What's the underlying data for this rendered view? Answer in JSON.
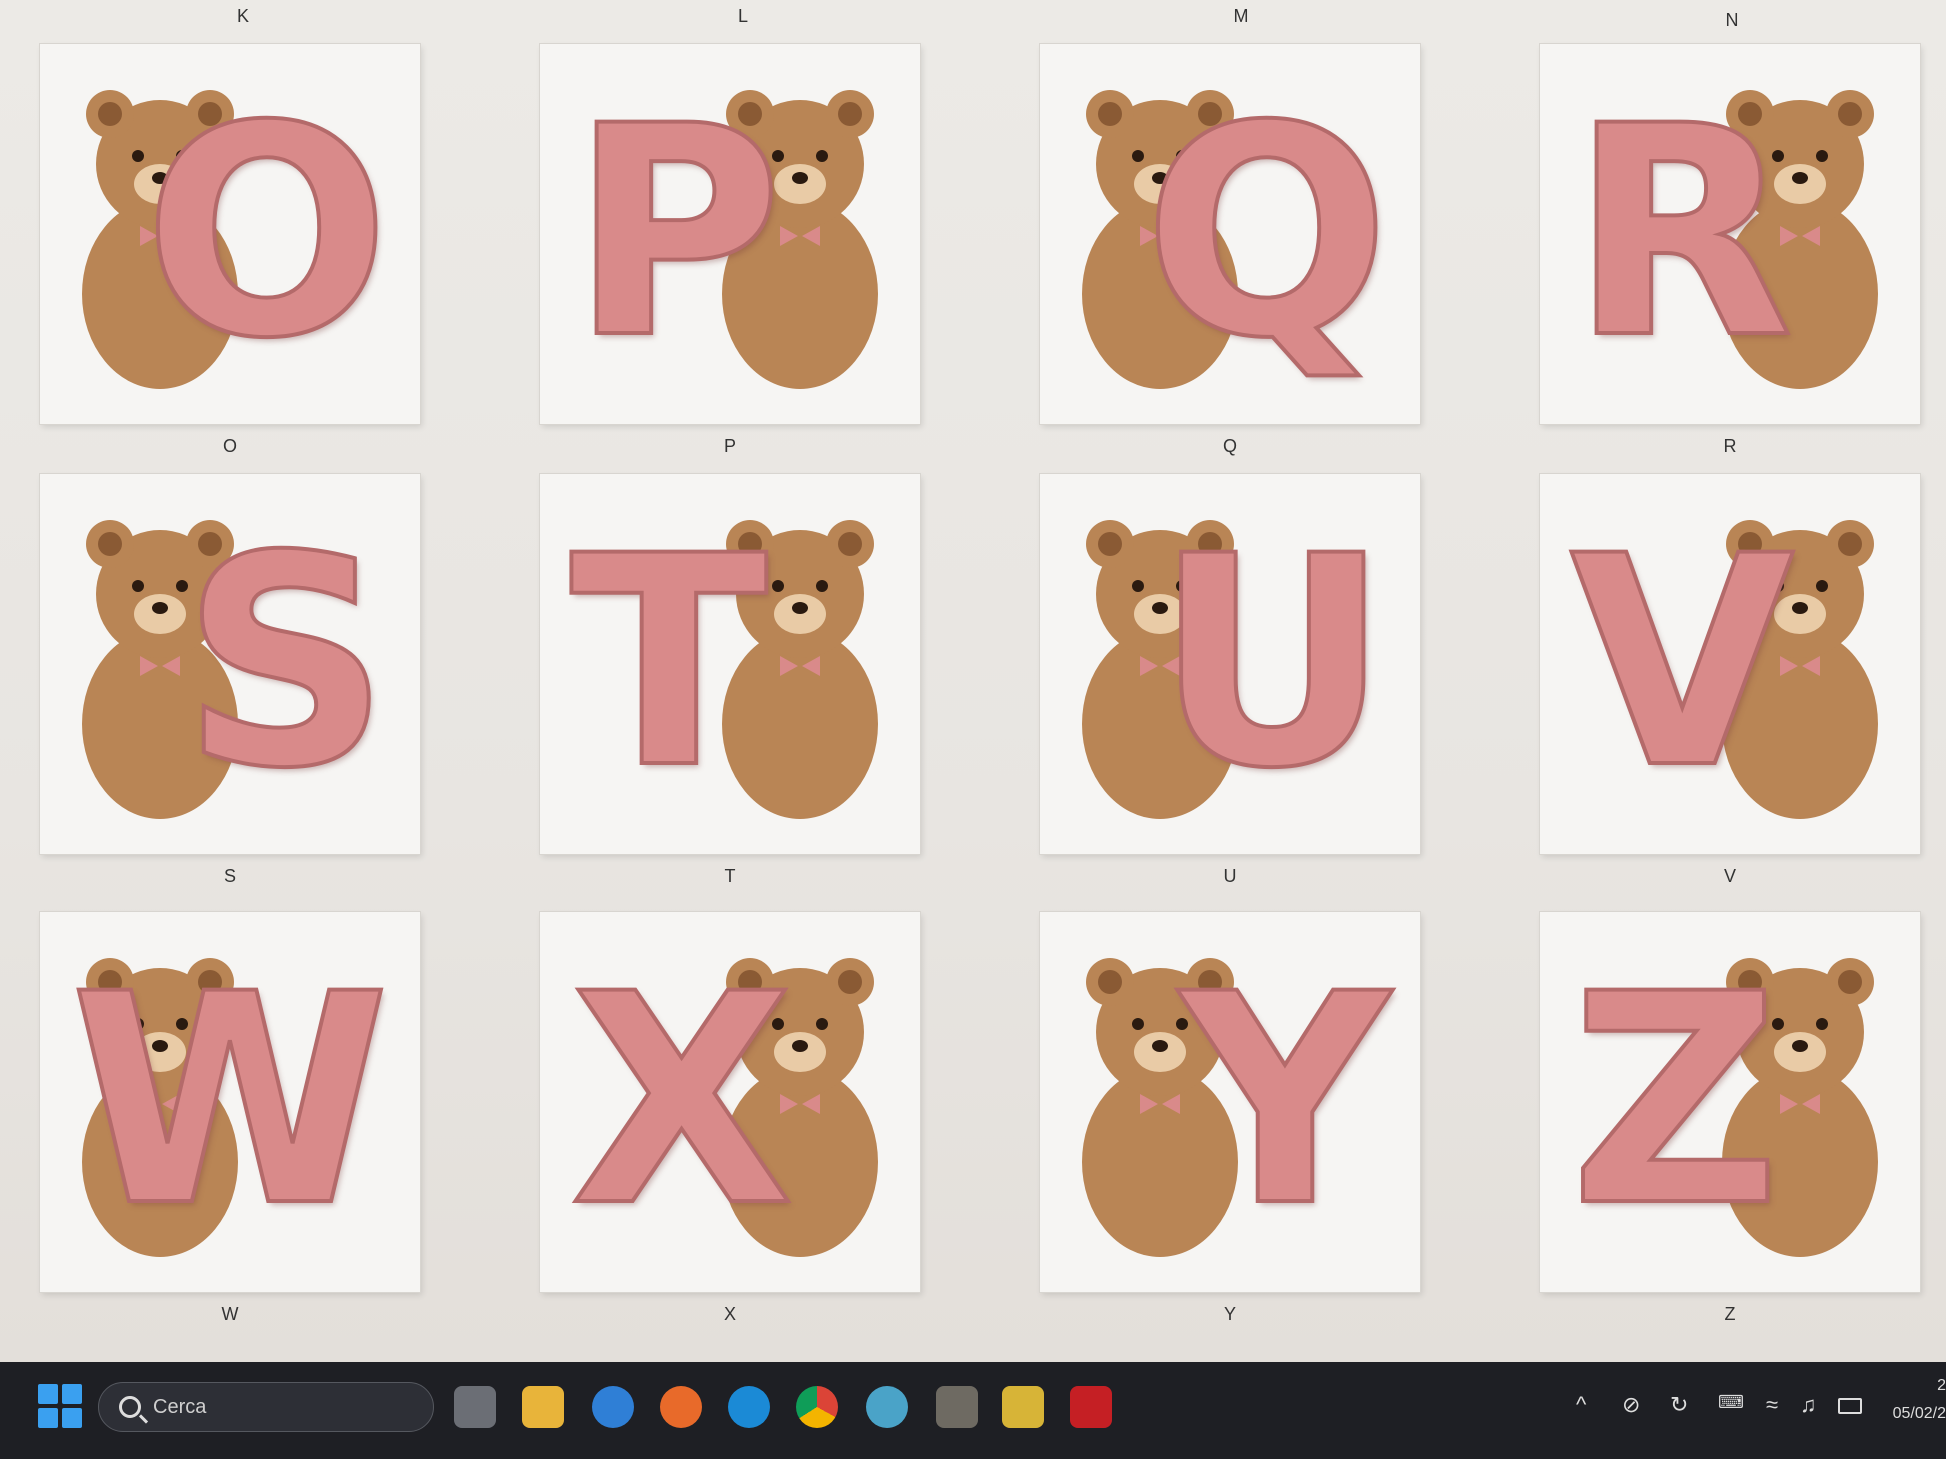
{
  "top_labels": [
    "K",
    "L",
    "M",
    "N"
  ],
  "tiles": [
    {
      "letter": "O",
      "caption": "O"
    },
    {
      "letter": "P",
      "caption": "P"
    },
    {
      "letter": "Q",
      "caption": "Q"
    },
    {
      "letter": "R",
      "caption": "R"
    },
    {
      "letter": "S",
      "caption": "S"
    },
    {
      "letter": "T",
      "caption": "T"
    },
    {
      "letter": "U",
      "caption": "U"
    },
    {
      "letter": "V",
      "caption": "V"
    },
    {
      "letter": "W",
      "caption": "W"
    },
    {
      "letter": "X",
      "caption": "X"
    },
    {
      "letter": "Y",
      "caption": "Y"
    },
    {
      "letter": "Z",
      "caption": "Z"
    }
  ],
  "taskbar": {
    "search_placeholder": "Cerca",
    "apps": [
      "task-view-icon",
      "file-explorer-icon",
      "help-icon",
      "firefox-icon",
      "edge-icon",
      "chrome-icon",
      "paint-icon",
      "gimp-icon",
      "app-icon",
      "acrobat-icon"
    ],
    "tray": [
      "chevron-up-icon",
      "notifications-off-icon",
      "sync-icon",
      "keyboard-icon",
      "wifi-icon",
      "volume-icon",
      "battery-icon"
    ],
    "clock_time": "2",
    "clock_date": "05/02/2"
  },
  "colors": {
    "tile_bg": "#f6f5f3",
    "gingham_pink": "#d98a8a",
    "gingham_light": "#f4dcd8",
    "bear_brown": "#b98555",
    "bear_dark": "#8a5a34",
    "taskbar_bg": "#1e1f24"
  }
}
